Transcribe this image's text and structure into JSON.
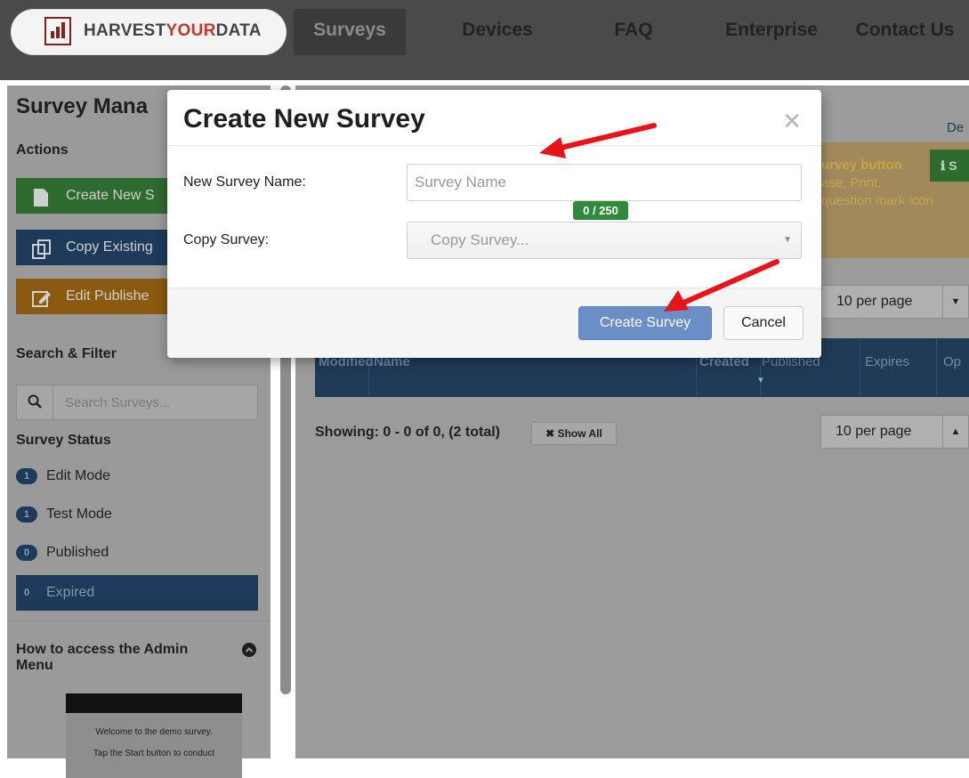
{
  "nav": {
    "logo_a": "HARVEST",
    "logo_b": "YOUR",
    "logo_c": "DATA",
    "items": [
      {
        "label": "Surveys"
      },
      {
        "label": "Devices"
      },
      {
        "label": "FAQ"
      },
      {
        "label": "Enterprise"
      },
      {
        "label": "Contact Us"
      }
    ]
  },
  "sidebar": {
    "title": "Survey Mana",
    "actions_heading": "Actions",
    "actions": [
      {
        "label": "Create New S",
        "icon": "file-icon",
        "color": "#2e6b2e"
      },
      {
        "label": "Copy Existing",
        "icon": "copy-icon",
        "color": "#1d3a5a"
      },
      {
        "label": "Edit Publishe",
        "icon": "edit-icon",
        "color": "#8a5a10"
      }
    ],
    "search_heading": "Search & Filter",
    "search_placeholder": "Search Surveys...",
    "status_heading": "Survey Status",
    "statuses": [
      {
        "count": "1",
        "label": "Edit Mode"
      },
      {
        "count": "1",
        "label": "Test Mode"
      },
      {
        "count": "0",
        "label": "Published"
      },
      {
        "count": "0",
        "label": "Expired"
      }
    ],
    "admin_heading_1": "How to access the Admin",
    "admin_heading_2": "Menu",
    "preview_text_1": "Welcome to the demo survey.",
    "preview_text_2": "Tap the Start button to conduct"
  },
  "main": {
    "link_fragment": "De",
    "info_line_1": "urvey button",
    "info_line_2": "ase, Print,",
    "info_line_3": "question mark icon",
    "info_button": "S",
    "per_page": "10 per page",
    "col_modified": "Modified",
    "col_name": "Name",
    "col_created": "Created",
    "col_published": "Published",
    "col_expires": "Expires",
    "col_options": "Op",
    "showing": "Showing: 0 - 0 of 0, (2 total)",
    "show_all": "Show All"
  },
  "modal": {
    "title": "Create New Survey",
    "name_label": "New Survey Name:",
    "name_placeholder": "Survey Name",
    "name_value": "",
    "char_count": "0 / 250",
    "copy_label": "Copy Survey:",
    "copy_selected": "Copy Survey...",
    "create_button": "Create Survey",
    "cancel_button": "Cancel"
  },
  "colors": {
    "accent": "#6a8fc7",
    "annotation_arrow": "#e8141a",
    "counter_green": "#2f8a3c"
  }
}
